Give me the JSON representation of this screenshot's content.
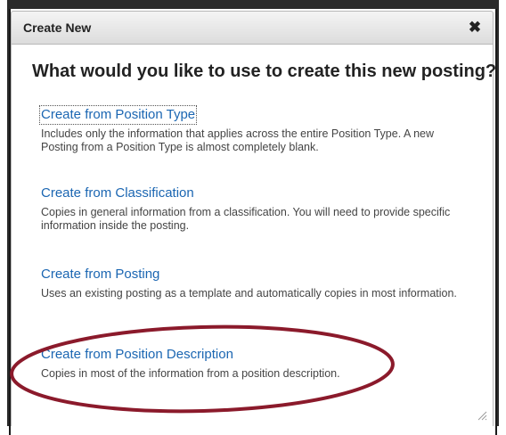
{
  "dialog": {
    "title": "Create New",
    "close_glyph": "✖",
    "question": "What would you like to use to create this new posting?"
  },
  "options": [
    {
      "label": "Create from Position Type",
      "description": "Includes only the information that applies across the entire Position Type. A new Posting from a Position Type is almost completely blank."
    },
    {
      "label": "Create from Classification",
      "description": "Copies in general information from a classification. You will need to provide specific information inside the posting."
    },
    {
      "label": "Create from Posting",
      "description": "Uses an existing posting as a template and automatically copies in most information."
    },
    {
      "label": "Create from Position Description",
      "description": "Copies in most of the information from a position description."
    }
  ],
  "colors": {
    "link": "#1b66b2",
    "highlight_ellipse": "#8b1a2b"
  },
  "icons": {
    "close": "close-icon",
    "resize": "resize-grip-icon"
  }
}
